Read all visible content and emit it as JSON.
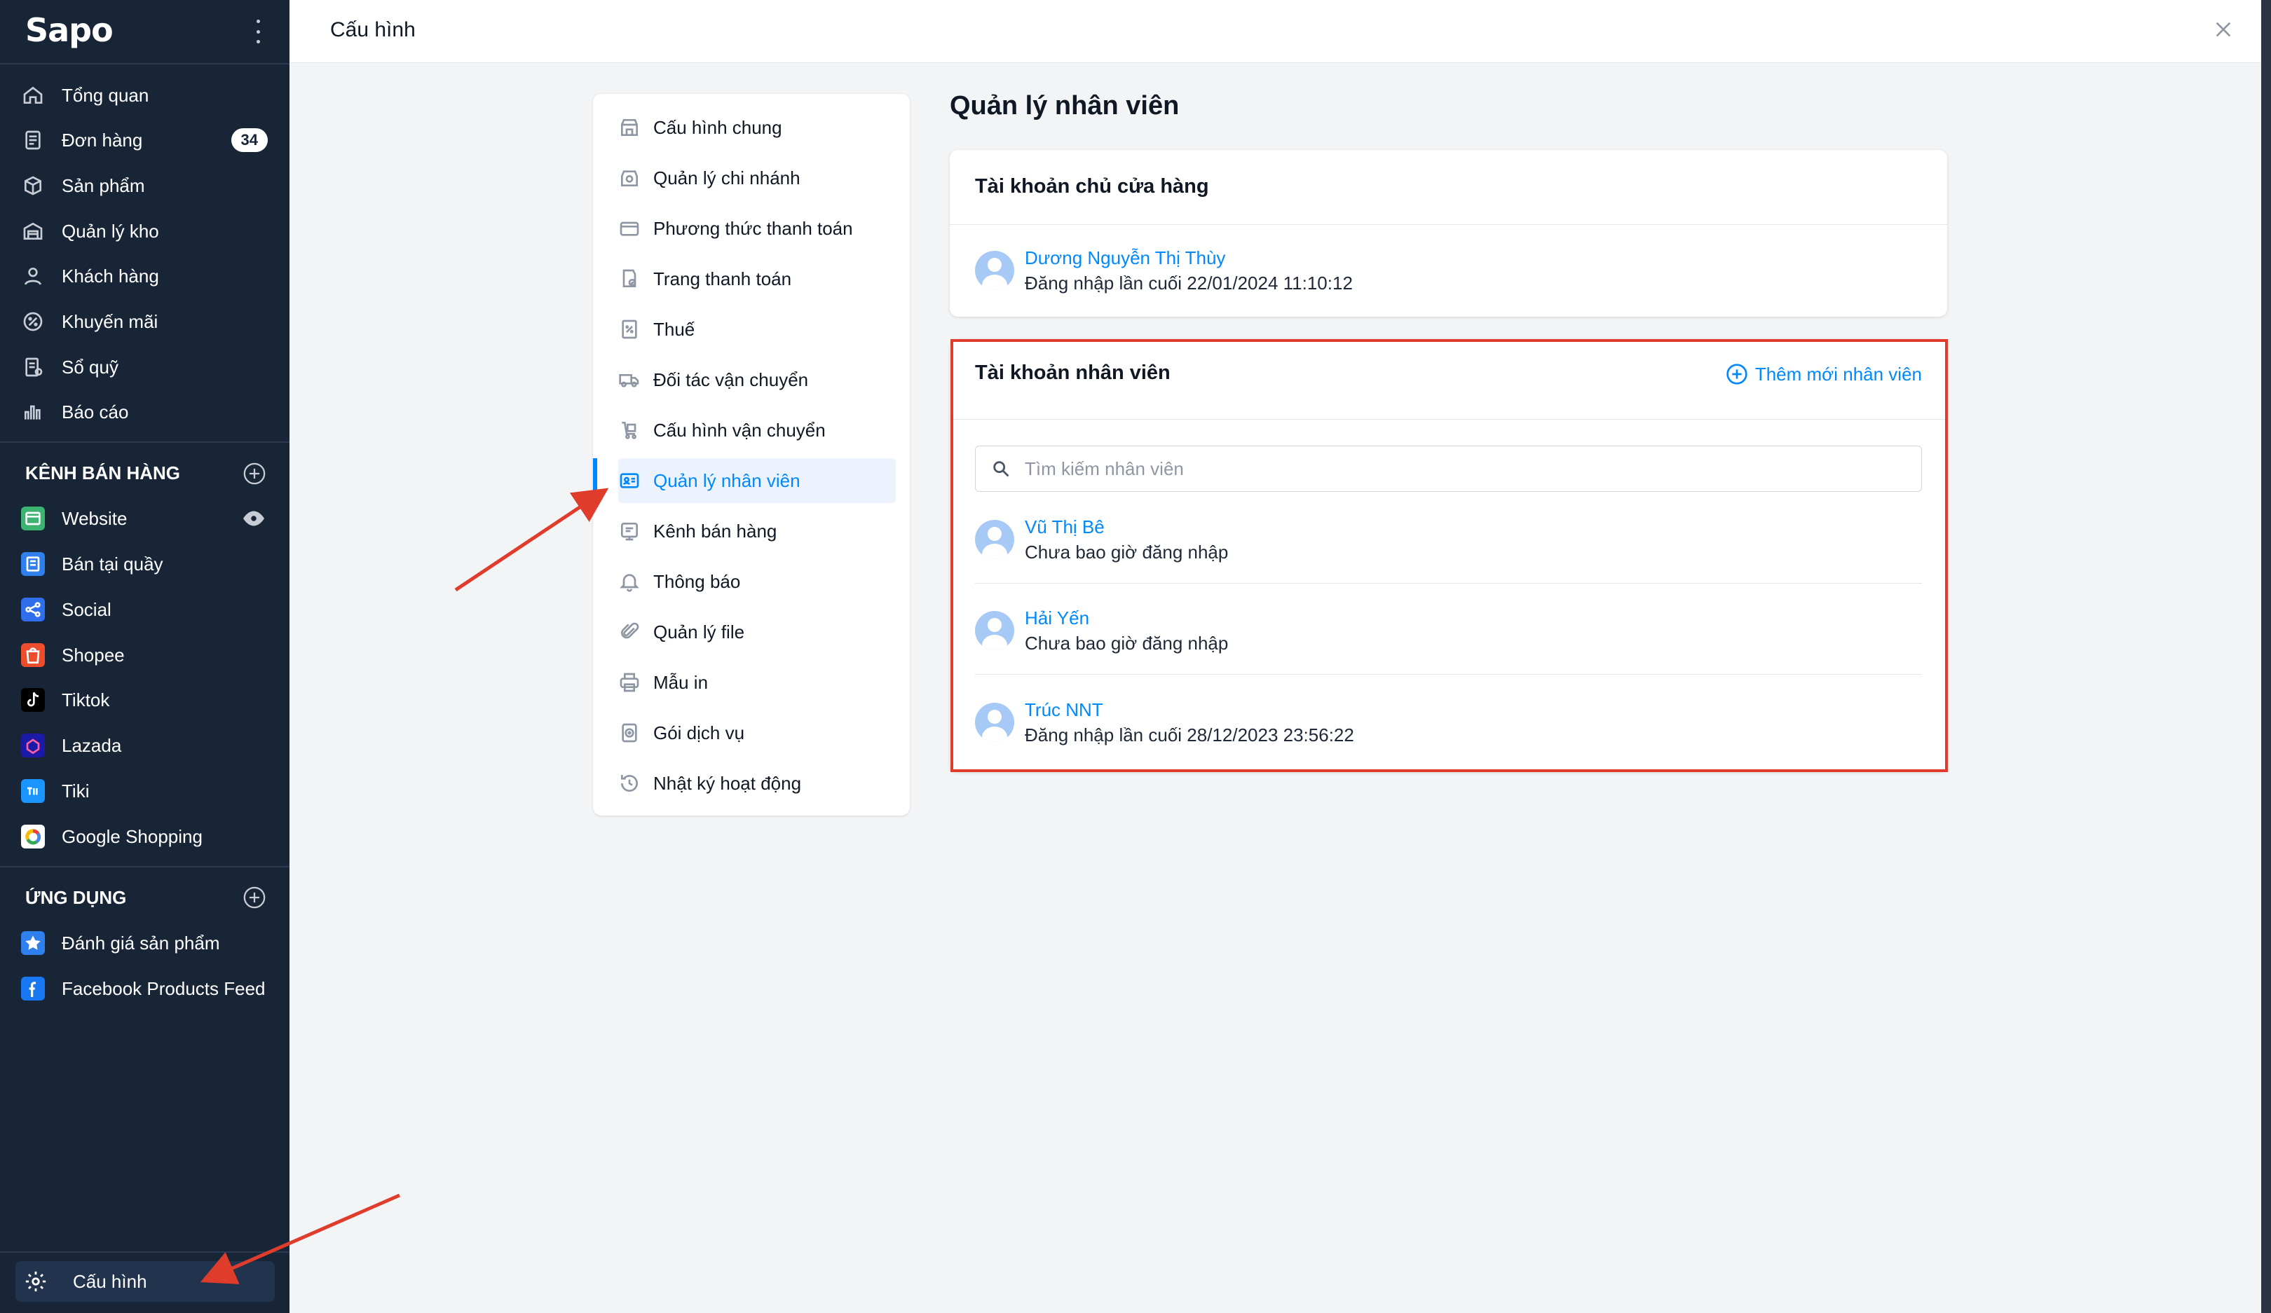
{
  "sidebar": {
    "logo": "Sapo",
    "nav": [
      {
        "label": "Tổng quan",
        "icon": "home-icon"
      },
      {
        "label": "Đơn hàng",
        "icon": "order-icon",
        "badge": "34"
      },
      {
        "label": "Sản phẩm",
        "icon": "box-icon"
      },
      {
        "label": "Quản lý kho",
        "icon": "warehouse-icon"
      },
      {
        "label": "Khách hàng",
        "icon": "customer-icon"
      },
      {
        "label": "Khuyến mãi",
        "icon": "discount-icon"
      },
      {
        "label": "Sổ quỹ",
        "icon": "cashbook-icon"
      },
      {
        "label": "Báo cáo",
        "icon": "report-icon"
      }
    ],
    "channels_title": "KÊNH BÁN HÀNG",
    "channels": [
      {
        "label": "Website",
        "icon": "website-icon",
        "color": "#3cb371"
      },
      {
        "label": "Bán tại quầy",
        "icon": "pos-icon",
        "color": "#2f80ed"
      },
      {
        "label": "Social",
        "icon": "social-icon",
        "color": "#2f6fed"
      },
      {
        "label": "Shopee",
        "icon": "shopee-icon",
        "color": "#ee4d2d"
      },
      {
        "label": "Tiktok",
        "icon": "tiktok-icon",
        "color": "#000000"
      },
      {
        "label": "Lazada",
        "icon": "lazada-icon",
        "color": "#1a1aa6"
      },
      {
        "label": "Tiki",
        "icon": "tiki-icon",
        "color": "#1a94ff"
      },
      {
        "label": "Google Shopping",
        "icon": "google-icon",
        "color": "#ffffff"
      }
    ],
    "apps_title": "ỨNG DỤNG",
    "apps": [
      {
        "label": "Đánh giá sản phẩm",
        "icon": "star-icon",
        "color": "#2f80ed"
      },
      {
        "label": "Facebook Products Feed",
        "icon": "facebook-icon",
        "color": "#1877f2"
      }
    ],
    "settings_label": "Cấu hình"
  },
  "header": {
    "title": "Cấu hình"
  },
  "settings_menu": [
    {
      "label": "Cấu hình chung"
    },
    {
      "label": "Quản lý chi nhánh"
    },
    {
      "label": "Phương thức thanh toán"
    },
    {
      "label": "Trang thanh toán"
    },
    {
      "label": "Thuế"
    },
    {
      "label": "Đối tác vận chuyển"
    },
    {
      "label": "Cấu hình vận chuyển"
    },
    {
      "label": "Quản lý nhân viên",
      "active": true
    },
    {
      "label": "Kênh bán hàng"
    },
    {
      "label": "Thông báo"
    },
    {
      "label": "Quản lý file"
    },
    {
      "label": "Mẫu in"
    },
    {
      "label": "Gói dịch vụ"
    },
    {
      "label": "Nhật ký hoạt động"
    }
  ],
  "main": {
    "title": "Quản lý nhân viên",
    "owner_card": {
      "title": "Tài khoản chủ cửa hàng",
      "name": "Dương Nguyễn Thị Thùy",
      "status": "Đăng nhập lần cuối 22/01/2024 11:10:12"
    },
    "staff_card": {
      "title": "Tài khoản nhân viên",
      "add_label": "Thêm mới nhân viên",
      "search_placeholder": "Tìm kiếm nhân viên",
      "staff": [
        {
          "name": "Vũ Thị Bê",
          "status": "Chưa bao giờ đăng nhập"
        },
        {
          "name": "Hải Yến",
          "status": "Chưa bao giờ đăng nhập"
        },
        {
          "name": "Trúc NNT",
          "status": "Đăng nhập lần cuối 28/12/2023 23:56:22"
        }
      ]
    }
  },
  "colors": {
    "accent": "#0088ff",
    "sidebar_bg": "#182537",
    "annotation": "#e03c2c"
  }
}
